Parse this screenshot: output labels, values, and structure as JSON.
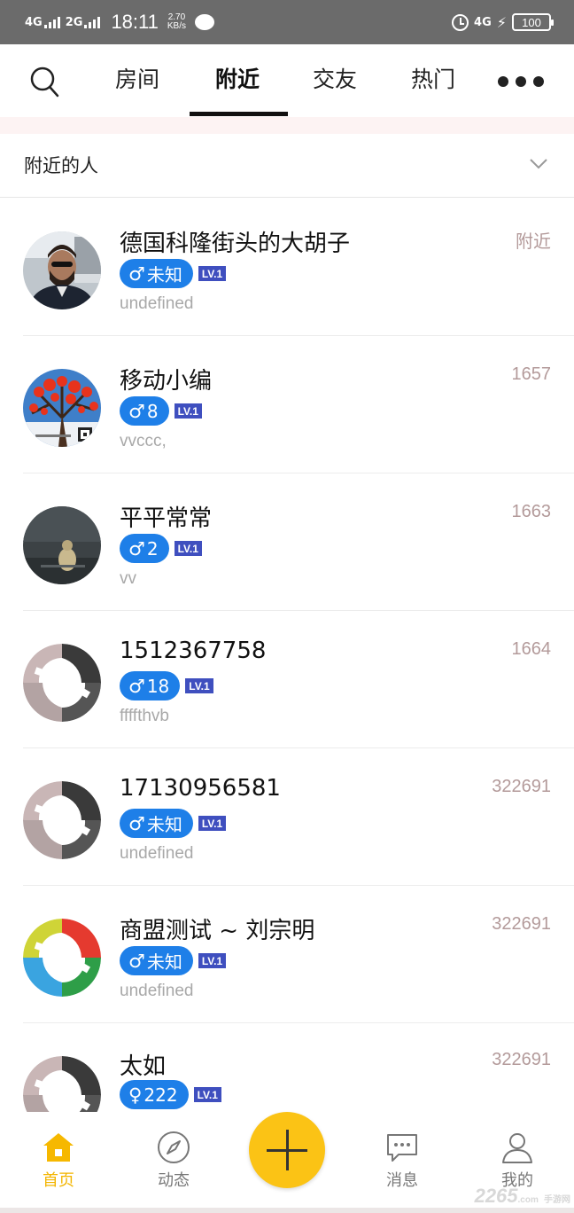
{
  "status_bar": {
    "network1": "4G",
    "network2": "2G",
    "time": "18:11",
    "speed_value": "2.70",
    "speed_unit": "KB/s",
    "network3": "4G",
    "battery": "100"
  },
  "top_nav": {
    "tabs": [
      {
        "label": "房间",
        "active": false
      },
      {
        "label": "附近",
        "active": true
      },
      {
        "label": "交友",
        "active": false
      },
      {
        "label": "热门",
        "active": false
      }
    ]
  },
  "section": {
    "title": "附近的人"
  },
  "users": [
    {
      "name": "德国科隆街头的大胡子",
      "gender_symbol": "♂",
      "gender_text": "未知",
      "level": "LV.1",
      "signature": "undefined",
      "distance": "附近",
      "avatar": "photo-man-sunglasses"
    },
    {
      "name": "移动小编",
      "gender_symbol": "♂",
      "gender_text": "8",
      "level": "LV.1",
      "signature": "vvccc,",
      "distance": "1657",
      "avatar": "photo-red-flowers"
    },
    {
      "name": "平平常常",
      "gender_symbol": "♂",
      "gender_text": "2",
      "level": "LV.1",
      "signature": "vv",
      "distance": "1663",
      "avatar": "photo-dark-figure"
    },
    {
      "name": "1512367758",
      "gender_symbol": "♂",
      "gender_text": "18",
      "level": "LV.1",
      "signature": "ffffthvb",
      "distance": "1664",
      "avatar": "default-s-logo-gray"
    },
    {
      "name": "17130956581",
      "gender_symbol": "♂",
      "gender_text": "未知",
      "level": "LV.1",
      "signature": "undefined",
      "distance": "322691",
      "avatar": "default-s-logo-gray"
    },
    {
      "name": "商盟测试 ~ 刘宗明",
      "gender_symbol": "♂",
      "gender_text": "未知",
      "level": "LV.1",
      "signature": "undefined",
      "distance": "322691",
      "avatar": "default-s-logo-color"
    },
    {
      "name": "太如",
      "gender_symbol": "♀",
      "gender_text": "222",
      "level": "LV.1",
      "signature": "",
      "distance": "322691",
      "avatar": "default-s-logo-gray"
    }
  ],
  "bottom_nav": {
    "items": [
      {
        "label": "首页",
        "icon": "home-icon",
        "active": true
      },
      {
        "label": "动态",
        "icon": "compass-icon",
        "active": false
      },
      {
        "label": "消息",
        "icon": "chat-bubble-icon",
        "active": false
      },
      {
        "label": "我的",
        "icon": "person-icon",
        "active": false
      }
    ],
    "fab_icon": "plus-icon"
  },
  "watermark": {
    "main": "2265",
    "sub": ".com",
    "small": "手游网"
  },
  "colors": {
    "accent_yellow": "#fbc315",
    "active_tab_label": "#f3b500",
    "gender_badge": "#1e7fe8",
    "level_badge": "#3f4fbf",
    "distance_text": "#b39a9a"
  }
}
